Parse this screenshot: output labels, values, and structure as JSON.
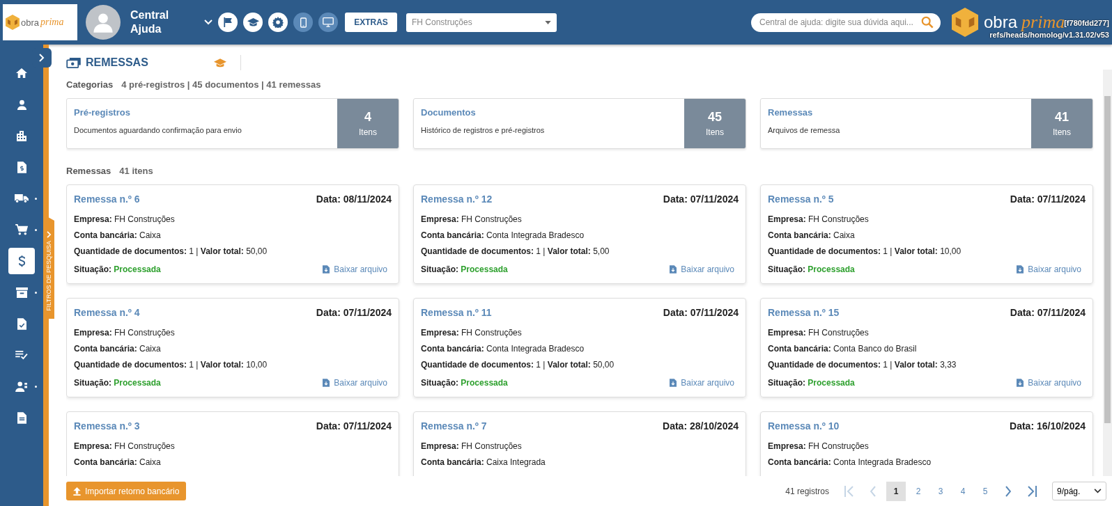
{
  "header": {
    "logo_text": "obra",
    "logo_script": "prima",
    "user_name": "Central Ajuda",
    "tool_buttons": [
      {
        "kind": "flag",
        "highlighted": false
      },
      {
        "kind": "graduation",
        "highlighted": false
      },
      {
        "kind": "gear",
        "highlighted": false
      },
      {
        "kind": "phone",
        "highlighted": true
      },
      {
        "kind": "monitor",
        "highlighted": true
      }
    ],
    "extras_button": "EXTRAS",
    "company_select": "FH Construções",
    "search": {
      "placeholder": "Central de ajuda: digite sua dúvida aqui..."
    },
    "brand_text": "obra",
    "brand_script": "prima",
    "build_hash": "[f780fdd277]",
    "build_ref": "refs/heads/homolog/v1.31.02/v53"
  },
  "sidebar": {
    "items": [
      {
        "kind": "home",
        "selected": false,
        "has_submenu": false
      },
      {
        "kind": "user",
        "selected": false,
        "has_submenu": false
      },
      {
        "kind": "building",
        "selected": false,
        "has_submenu": false
      },
      {
        "kind": "invoice",
        "selected": false,
        "has_submenu": false
      },
      {
        "kind": "truck",
        "selected": false,
        "has_submenu": true
      },
      {
        "kind": "cart",
        "selected": false,
        "has_submenu": true
      },
      {
        "kind": "dollar",
        "selected": true,
        "has_submenu": false
      },
      {
        "kind": "archive",
        "selected": false,
        "has_submenu": true
      },
      {
        "kind": "doc-check",
        "selected": false,
        "has_submenu": false
      },
      {
        "kind": "list-check",
        "selected": false,
        "has_submenu": false
      },
      {
        "kind": "people",
        "selected": false,
        "has_submenu": true
      },
      {
        "kind": "document",
        "selected": false,
        "has_submenu": false
      }
    ]
  },
  "filter_tab": "FILTROS DE PESQUISA",
  "page_title": "REMESSAS",
  "categories": {
    "label": "Categorias",
    "summary": "4 pré-registros | 45 documentos | 41 remessas",
    "items": [
      {
        "title": "Pré-registros",
        "description": "Documentos aguardando confirmação para envio",
        "count": "4",
        "unit": "Itens"
      },
      {
        "title": "Documentos",
        "description": "Histórico de registros e pré-registros",
        "count": "45",
        "unit": "Itens"
      },
      {
        "title": "Remessas",
        "description": "Arquivos de remessa",
        "count": "41",
        "unit": "Itens"
      }
    ]
  },
  "list": {
    "label": "Remessas",
    "count": "41 itens",
    "cards": [
      {
        "title": "Remessa n.º 6",
        "date": "Data: 08/11/2024",
        "lines": [
          [
            {
              "label": "Empresa:",
              "value": "FH Construções"
            }
          ],
          [
            {
              "label": "Conta bancária:",
              "value": "Caixa"
            }
          ],
          [
            {
              "label": "Quantidade de documentos:",
              "value": "1"
            },
            {
              "separator": "|"
            },
            {
              "label": "Valor total:",
              "value": "50,00"
            }
          ]
        ],
        "status_label": "Situação:",
        "status": "Processada",
        "download": "Baixar arquivo"
      },
      {
        "title": "Remessa n.º 12",
        "date": "Data: 07/11/2024",
        "lines": [
          [
            {
              "label": "Empresa:",
              "value": "FH Construções"
            }
          ],
          [
            {
              "label": "Conta bancária:",
              "value": "Conta Integrada Bradesco"
            }
          ],
          [
            {
              "label": "Quantidade de documentos:",
              "value": "1"
            },
            {
              "separator": "|"
            },
            {
              "label": "Valor total:",
              "value": "5,00"
            }
          ]
        ],
        "status_label": "Situação:",
        "status": "Processada",
        "download": "Baixar arquivo"
      },
      {
        "title": "Remessa n.º 5",
        "date": "Data: 07/11/2024",
        "lines": [
          [
            {
              "label": "Empresa:",
              "value": "FH Construções"
            }
          ],
          [
            {
              "label": "Conta bancária:",
              "value": "Caixa"
            }
          ],
          [
            {
              "label": "Quantidade de documentos:",
              "value": "1"
            },
            {
              "separator": "|"
            },
            {
              "label": "Valor total:",
              "value": "10,00"
            }
          ]
        ],
        "status_label": "Situação:",
        "status": "Processada",
        "download": "Baixar arquivo"
      },
      {
        "title": "Remessa n.º 4",
        "date": "Data: 07/11/2024",
        "lines": [
          [
            {
              "label": "Empresa:",
              "value": "FH Construções"
            }
          ],
          [
            {
              "label": "Conta bancária:",
              "value": "Caixa"
            }
          ],
          [
            {
              "label": "Quantidade de documentos:",
              "value": "1"
            },
            {
              "separator": "|"
            },
            {
              "label": "Valor total:",
              "value": "10,00"
            }
          ]
        ],
        "status_label": "Situação:",
        "status": "Processada",
        "download": "Baixar arquivo"
      },
      {
        "title": "Remessa n.º 11",
        "date": "Data: 07/11/2024",
        "lines": [
          [
            {
              "label": "Empresa:",
              "value": "FH Construções"
            }
          ],
          [
            {
              "label": "Conta bancária:",
              "value": "Conta Integrada Bradesco"
            }
          ],
          [
            {
              "label": "Quantidade de documentos:",
              "value": "1"
            },
            {
              "separator": "|"
            },
            {
              "label": "Valor total:",
              "value": "50,00"
            }
          ]
        ],
        "status_label": "Situação:",
        "status": "Processada",
        "download": "Baixar arquivo"
      },
      {
        "title": "Remessa n.º 15",
        "date": "Data: 07/11/2024",
        "lines": [
          [
            {
              "label": "Empresa:",
              "value": "FH Construções"
            }
          ],
          [
            {
              "label": "Conta bancária:",
              "value": "Conta Banco do Brasil"
            }
          ],
          [
            {
              "label": "Quantidade de documentos:",
              "value": "1"
            },
            {
              "separator": "|"
            },
            {
              "label": "Valor total:",
              "value": "3,33"
            }
          ]
        ],
        "status_label": "Situação:",
        "status": "Processada",
        "download": "Baixar arquivo"
      },
      {
        "title": "Remessa n.º 3",
        "date": "Data: 07/11/2024",
        "lines": [
          [
            {
              "label": "Empresa:",
              "value": "FH Construções"
            }
          ],
          [
            {
              "label": "Conta bancária:",
              "value": "Caixa"
            }
          ]
        ]
      },
      {
        "title": "Remessa n.º 7",
        "date": "Data: 28/10/2024",
        "lines": [
          [
            {
              "label": "Empresa:",
              "value": "FH Construções"
            }
          ],
          [
            {
              "label": "Conta bancária:",
              "value": "Caixa Integrada"
            }
          ]
        ]
      },
      {
        "title": "Remessa n.º 10",
        "date": "Data: 16/10/2024",
        "lines": [
          [
            {
              "label": "Empresa:",
              "value": "FH Construções"
            }
          ],
          [
            {
              "label": "Conta bancária:",
              "value": "Conta Integrada Bradesco"
            }
          ]
        ]
      }
    ]
  },
  "footer": {
    "import_button": "Importar retorno bancário",
    "records": "41 registros",
    "first_disabled": true,
    "prev_disabled": true,
    "pages": [
      {
        "label": "1",
        "selected": true
      },
      {
        "label": "2",
        "selected": false
      },
      {
        "label": "3",
        "selected": false
      },
      {
        "label": "4",
        "selected": false
      },
      {
        "label": "5",
        "selected": false
      }
    ],
    "per_page": "9/pág."
  }
}
